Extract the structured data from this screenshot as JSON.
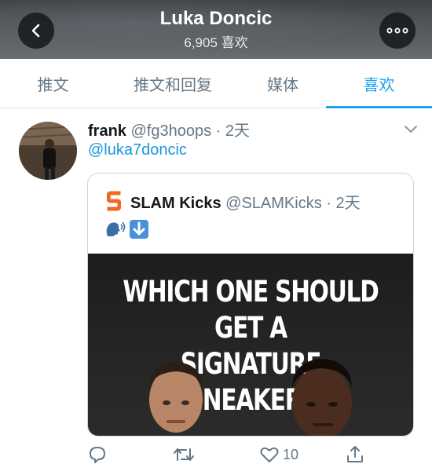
{
  "header": {
    "title": "Luka Doncic",
    "subtitle": "6,905 喜欢",
    "back_icon": "chevron-left-icon",
    "more_icon": "more-horizontal-icon"
  },
  "tabs": [
    {
      "label": "推文",
      "active": false
    },
    {
      "label": "推文和回复",
      "active": false
    },
    {
      "label": "媒体",
      "active": false
    },
    {
      "label": "喜欢",
      "active": true
    }
  ],
  "tweet": {
    "author_name": "frank",
    "author_handle": "@fg3hoops",
    "separator": "·",
    "time": "2天",
    "text": "@luka7doncic",
    "quoted": {
      "author_name": "SLAM Kicks",
      "author_handle": "@SLAMKicks",
      "separator": "·",
      "time": "2天",
      "emoji": [
        "speaking-head-emoji",
        "down-arrow-emoji"
      ],
      "image_headline_line1": "WHICH ONE SHOULD GET A",
      "image_headline_line2": "SIGNATURE SNEAKER?"
    },
    "actions": {
      "reply_icon": "reply-icon",
      "retweet_icon": "retweet-icon",
      "like_icon": "heart-icon",
      "like_count": "10",
      "share_icon": "share-icon"
    }
  },
  "colors": {
    "accent": "#1da1f2",
    "link": "#1b95e0",
    "muted": "#657786",
    "text": "#14171a",
    "slam_orange": "#f26722"
  }
}
